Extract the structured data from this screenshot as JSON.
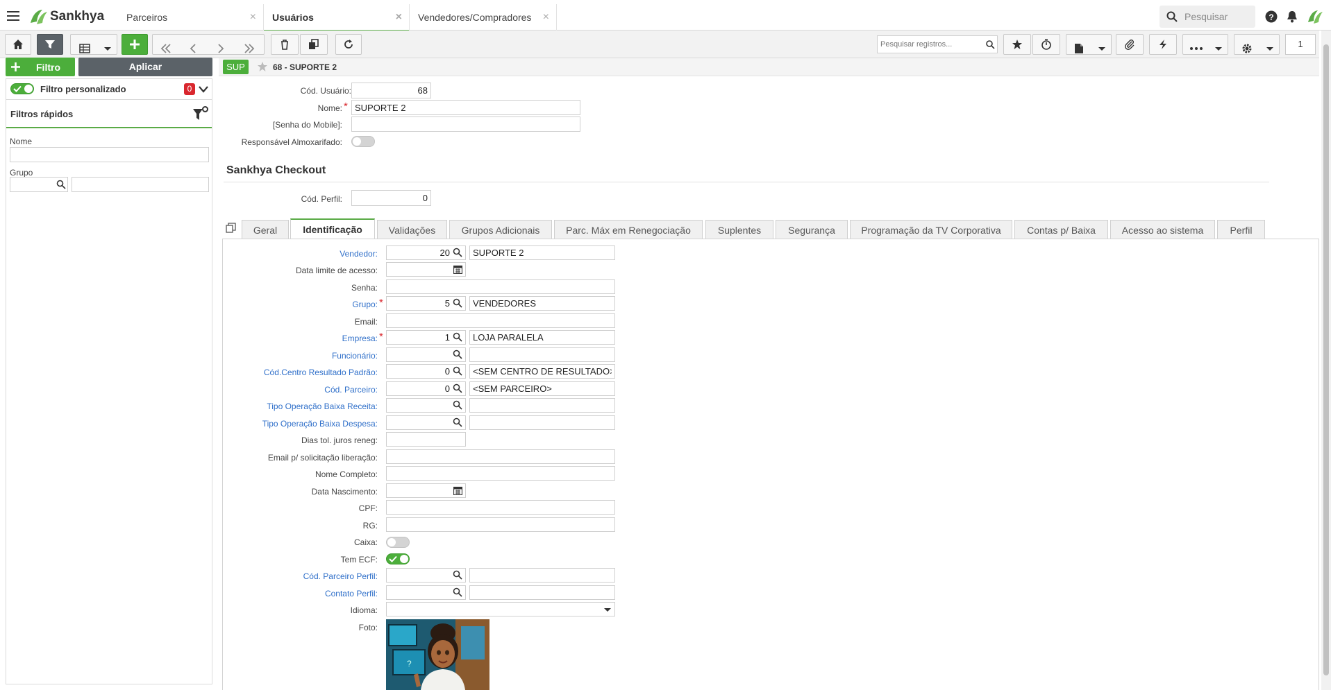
{
  "app": {
    "brand": "Sankhya",
    "search_placeholder": "Pesquisar"
  },
  "tabs": [
    {
      "label": "Parceiros"
    },
    {
      "label": "Usuários"
    },
    {
      "label": "Vendedores/Compradores"
    }
  ],
  "toolbar": {
    "search_placeholder": "Pesquisar registros...",
    "page_number": "1"
  },
  "filter": {
    "add_label": "Filtro",
    "apply_label": "Aplicar",
    "custom_label": "Filtro personalizado",
    "custom_count": "0",
    "quick_title": "Filtros rápidos",
    "name_label": "Nome",
    "group_label": "Grupo"
  },
  "record": {
    "badge": "SUP",
    "title": "68 - SUPORTE 2"
  },
  "header_fields": {
    "cod_usuario_label": "Cód. Usuário:",
    "cod_usuario": "68",
    "nome_label": "Nome:",
    "nome": "SUPORTE 2",
    "senha_mobile_label": "[Senha do Mobile]:",
    "resp_almox_label": "Responsável Almoxarifado:",
    "checkout_title": "Sankhya Checkout",
    "cod_perfil_label": "Cód. Perfil:",
    "cod_perfil": "0"
  },
  "form_tabs": [
    {
      "label": "Geral"
    },
    {
      "label": "Identificação"
    },
    {
      "label": "Validações"
    },
    {
      "label": "Grupos Adicionais"
    },
    {
      "label": "Parc. Máx em Renegociação"
    },
    {
      "label": "Suplentes"
    },
    {
      "label": "Segurança"
    },
    {
      "label": "Programação da TV Corporativa"
    },
    {
      "label": "Contas p/ Baixa"
    },
    {
      "label": "Acesso ao sistema"
    },
    {
      "label": "Perfil"
    }
  ],
  "fields": {
    "vendedor_label": "Vendedor:",
    "vendedor_code": "20",
    "vendedor_desc": "SUPORTE 2",
    "data_limite_label": "Data limite de acesso:",
    "senha_label": "Senha:",
    "grupo_label": "Grupo:",
    "grupo_code": "5",
    "grupo_desc": "VENDEDORES",
    "email_label": "Email:",
    "empresa_label": "Empresa:",
    "empresa_code": "1",
    "empresa_desc": "LOJA PARALELA",
    "funcionario_label": "Funcionário:",
    "centro_label": "Cód.Centro Resultado Padrão:",
    "centro_code": "0",
    "centro_desc": "<SEM CENTRO DE RESULTADO>",
    "parceiro_label": "Cód. Parceiro:",
    "parceiro_code": "0",
    "parceiro_desc": "<SEM PARCEIRO>",
    "tipo_receita_label": "Tipo Operação Baixa Receita:",
    "tipo_despesa_label": "Tipo Operação Baixa Despesa:",
    "dias_juros_label": "Dias tol. juros reneg:",
    "email_lib_label": "Email p/ solicitação liberação:",
    "nome_completo_label": "Nome Completo:",
    "data_nasc_label": "Data Nascimento:",
    "cpf_label": "CPF:",
    "rg_label": "RG:",
    "caixa_label": "Caixa:",
    "tem_ecf_label": "Tem ECF:",
    "parceiro_perfil_label": "Cód. Parceiro Perfil:",
    "contato_perfil_label": "Contato Perfil:",
    "idioma_label": "Idioma:",
    "foto_label": "Foto:"
  },
  "colors": {
    "accent": "#4cae3b",
    "link": "#2f6fc9",
    "required": "#d9272e"
  }
}
